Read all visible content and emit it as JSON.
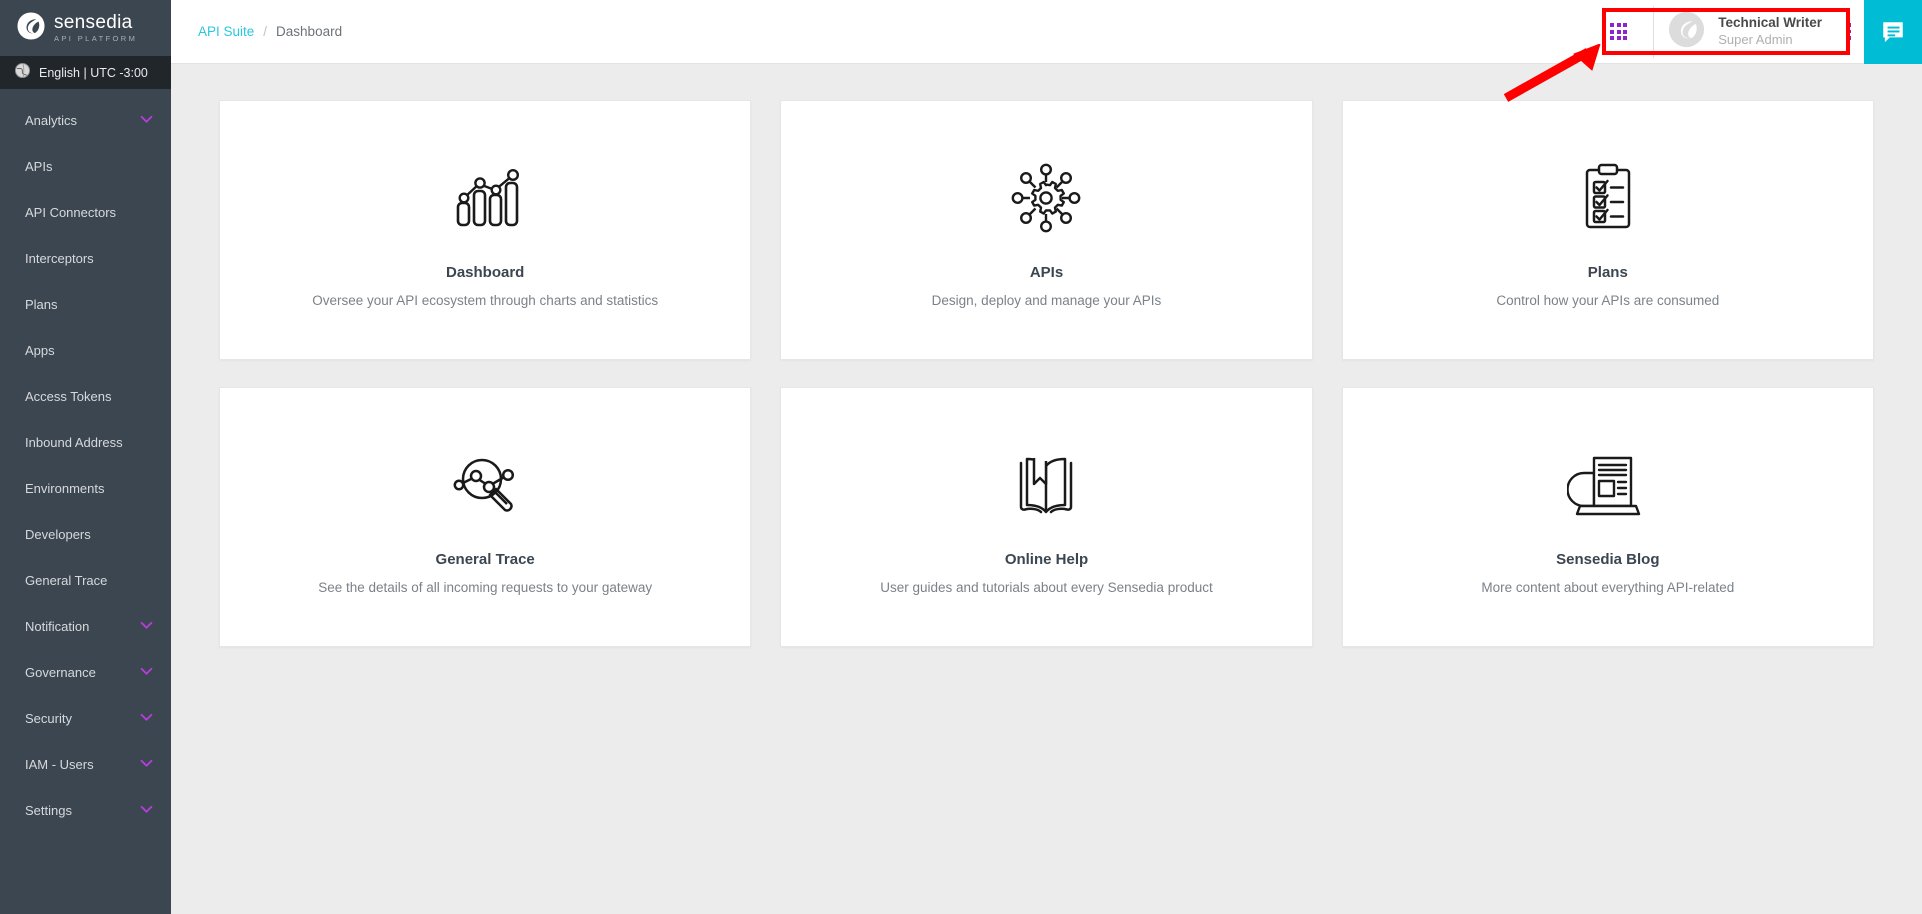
{
  "sidebar": {
    "logo": {
      "mark_icon": "sensedia-logo-icon",
      "word": "sensedia",
      "subtitle": "API PLATFORM"
    },
    "language_bar": {
      "icon": "globe-icon",
      "label": "English | UTC -3:00"
    },
    "items": [
      {
        "label": "Analytics",
        "expandable": true,
        "chevron_icon": "chevron-down-icon"
      },
      {
        "label": "APIs",
        "expandable": false,
        "chevron_icon": ""
      },
      {
        "label": "API Connectors",
        "expandable": false,
        "chevron_icon": ""
      },
      {
        "label": "Interceptors",
        "expandable": false,
        "chevron_icon": ""
      },
      {
        "label": "Plans",
        "expandable": false,
        "chevron_icon": ""
      },
      {
        "label": "Apps",
        "expandable": false,
        "chevron_icon": ""
      },
      {
        "label": "Access Tokens",
        "expandable": false,
        "chevron_icon": ""
      },
      {
        "label": "Inbound Address",
        "expandable": false,
        "chevron_icon": ""
      },
      {
        "label": "Environments",
        "expandable": false,
        "chevron_icon": ""
      },
      {
        "label": "Developers",
        "expandable": false,
        "chevron_icon": ""
      },
      {
        "label": "General Trace",
        "expandable": false,
        "chevron_icon": ""
      },
      {
        "label": "Notification",
        "expandable": true,
        "chevron_icon": "chevron-down-icon"
      },
      {
        "label": "Governance",
        "expandable": true,
        "chevron_icon": "chevron-down-icon"
      },
      {
        "label": "Security",
        "expandable": true,
        "chevron_icon": "chevron-down-icon"
      },
      {
        "label": "IAM - Users",
        "expandable": true,
        "chevron_icon": "chevron-down-icon"
      },
      {
        "label": "Settings",
        "expandable": true,
        "chevron_icon": "chevron-down-icon"
      }
    ]
  },
  "topbar": {
    "breadcrumb": {
      "root": "API Suite",
      "separator": "/",
      "current": "Dashboard"
    },
    "apps_grid_icon": "grid-apps-icon",
    "user": {
      "avatar_icon": "user-avatar-icon",
      "name": "Technical Writer",
      "role": "Super Admin"
    },
    "kebab_icon": "kebab-menu-icon",
    "chat_icon": "chat-bubble-icon"
  },
  "main": {
    "cards": [
      {
        "icon": "bar-chart-line-icon",
        "title": "Dashboard",
        "description": "Oversee your API ecosystem through charts and statistics"
      },
      {
        "icon": "gear-network-icon",
        "title": "APIs",
        "description": "Design, deploy and manage your APIs"
      },
      {
        "icon": "clipboard-checklist-icon",
        "title": "Plans",
        "description": "Control how your APIs are consumed"
      },
      {
        "icon": "magnifier-network-icon",
        "title": "General Trace",
        "description": "See the details of all incoming requests to your gateway"
      },
      {
        "icon": "open-book-bookmark-icon",
        "title": "Online Help",
        "description": "User guides and tutorials about every Sensedia product"
      },
      {
        "icon": "newspaper-laptop-icon",
        "title": "Sensedia Blog",
        "description": "More content about everything API-related"
      }
    ]
  },
  "annotations": {
    "highlight_box_color": "#ff0000",
    "arrow_color": "#ff0000",
    "target": "user-block"
  },
  "colors": {
    "sidebar_bg": "#3c4650",
    "lang_bar_bg": "#21262b",
    "accent_purple": "#8e24cc",
    "accent_cyan": "#00bcd4",
    "breadcrumb_link": "#29c7e0",
    "content_bg": "#ececec"
  }
}
